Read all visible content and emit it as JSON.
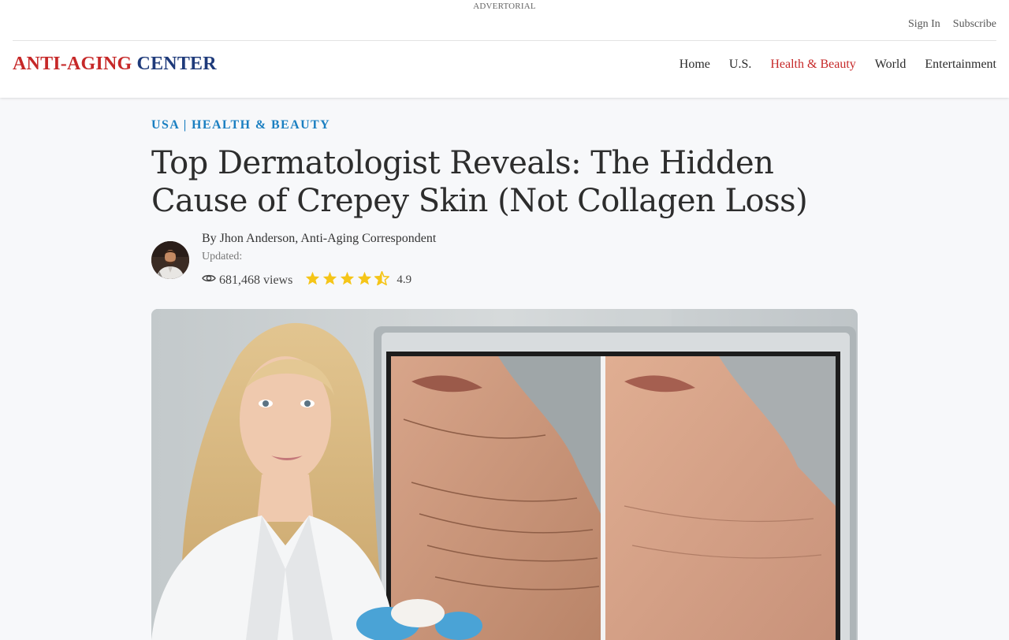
{
  "header": {
    "advertorial": "ADVERTORIAL",
    "topbar": {
      "sign_in": "Sign In",
      "subscribe": "Subscribe"
    },
    "logo": {
      "part1": "ANTI-AGING",
      "part2": "CENTER"
    },
    "nav": [
      {
        "label": "Home",
        "active": false
      },
      {
        "label": "U.S.",
        "active": false
      },
      {
        "label": "Health & Beauty",
        "active": true
      },
      {
        "label": "World",
        "active": false
      },
      {
        "label": "Entertainment",
        "active": false
      }
    ]
  },
  "article": {
    "kicker": "USA | HEALTH & BEAUTY",
    "title": "Top Dermatologist Reveals: The Hidden Cause of Crepey Skin (Not Collagen Loss)",
    "byline": "By Jhon Anderson, Anti-Aging Correspondent",
    "updated": "Updated:",
    "views": "681,468 views",
    "rating": {
      "value": "4.9",
      "stars": 4.5,
      "max": 5
    }
  },
  "colors": {
    "accent_red": "#c62828",
    "logo_blue": "#1e3a7a",
    "kicker_blue": "#1a7fc1",
    "star_gold": "#f5c518"
  },
  "icons": {
    "views": "eye-icon",
    "star": "star-icon",
    "half_star": "star-half-icon"
  }
}
